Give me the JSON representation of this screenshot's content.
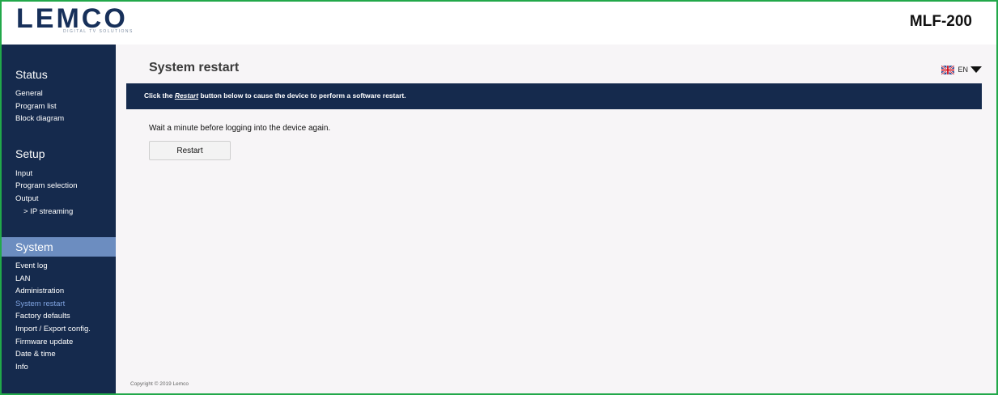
{
  "header": {
    "logo_text": "LEMCO",
    "logo_tagline": "DIGITAL TV SOLUTIONS",
    "model": "MLF-200"
  },
  "sidebar": {
    "status": {
      "title": "Status",
      "items": [
        "General",
        "Program list",
        "Block diagram"
      ]
    },
    "setup": {
      "title": "Setup",
      "items": [
        "Input",
        "Program selection",
        "Output",
        "> IP streaming"
      ]
    },
    "system": {
      "title": "System",
      "items": [
        "Event log",
        "LAN",
        "Administration",
        "System restart",
        "Factory defaults",
        "Import / Export config.",
        "Firmware update",
        "Date & time",
        "Info"
      ],
      "active": "System restart"
    }
  },
  "main": {
    "title": "System restart",
    "language": {
      "label": "EN",
      "flag": "uk-flag-icon"
    },
    "banner": {
      "prefix": "Click the",
      "link": "Restart",
      "suffix": "button below to cause the device to perform a software restart."
    },
    "note": "Wait a minute before logging into the device again.",
    "restart_button": "Restart",
    "copyright": "Copyright © 2019 Lemco"
  },
  "colors": {
    "navy": "#152a4d",
    "system_highlight": "#6c8dc0",
    "active_link": "#7fa3e0",
    "frame_border": "#22a84a",
    "content_bg": "#f7f5f7"
  }
}
